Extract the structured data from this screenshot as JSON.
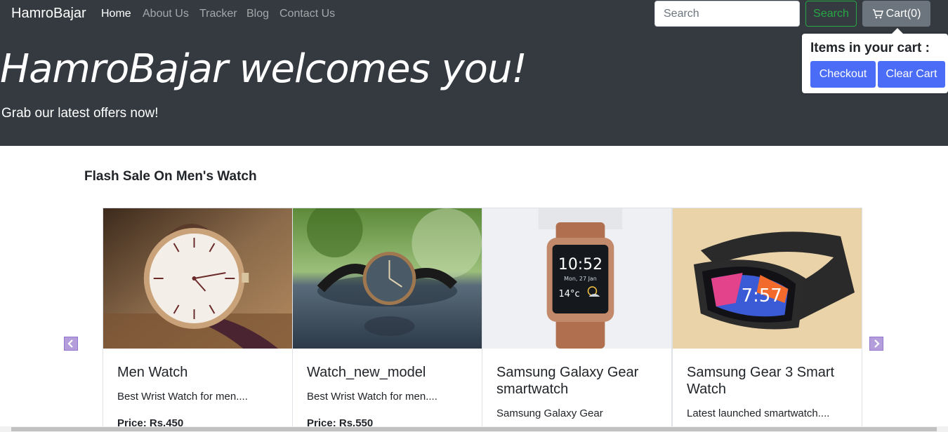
{
  "navbar": {
    "brand": "HamroBajar",
    "links": [
      "Home",
      "About Us",
      "Tracker",
      "Blog",
      "Contact Us"
    ],
    "search_placeholder": "Search",
    "search_button": "Search",
    "cart_label": "Cart(0)"
  },
  "hero": {
    "title": "HamroBajar welcomes you!",
    "subtitle": "Grab our latest offers now!"
  },
  "cart_popover": {
    "title": "Items in your cart :",
    "checkout": "Checkout",
    "clear": "Clear Cart"
  },
  "section": {
    "title": "Flash Sale On Men's Watch"
  },
  "products": [
    {
      "name": "Men Watch",
      "desc": "Best Wrist Watch for men....",
      "price": "Price: Rs.450"
    },
    {
      "name": "Watch_new_model",
      "desc": "Best Wrist Watch for men....",
      "price": "Price: Rs.550"
    },
    {
      "name": "Samsung Galaxy Gear smartwatch",
      "desc": "Samsung Galaxy Gear",
      "price": ""
    },
    {
      "name": "Samsung Gear 3 Smart Watch",
      "desc": "Latest launched smartwatch....",
      "price": ""
    }
  ],
  "watch_faces": {
    "gear_time": "10:52",
    "gear_date": "Mon, 27 Jan",
    "gear_temp": "14°c",
    "fit_time": "7:57"
  },
  "icons": [
    "cart-icon",
    "chevron-left-icon",
    "chevron-right-icon"
  ],
  "colors": {
    "navbar": "#343a40",
    "success": "#28a745",
    "primary": "#4a6cf7",
    "secondary": "#6c757d"
  }
}
